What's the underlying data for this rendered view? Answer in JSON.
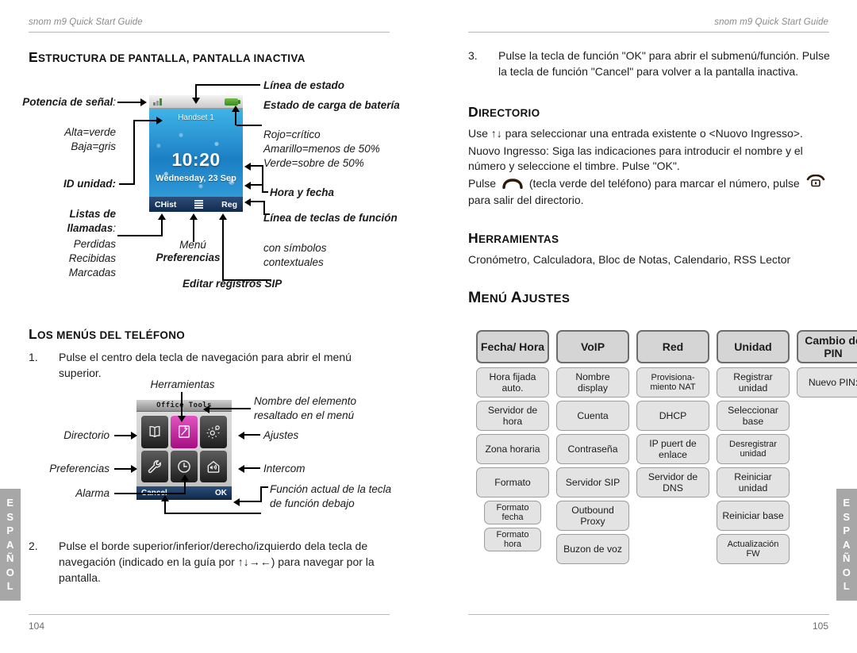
{
  "header": {
    "left_running_head": "snom m9 Quick Start Guide",
    "right_running_head": "snom m9 Quick Start Guide",
    "page_left": "104",
    "page_right": "105",
    "lang_tab": "ESPAÑOL"
  },
  "left_column": {
    "heading_screen_structure": {
      "cap": "E",
      "rest": "STRUCTURA DE PANTALLA, PANTALLA INACTIVA"
    },
    "heading_phone_menus": {
      "cap": "L",
      "rest": "OS MENÚS DEL TELÉFONO"
    },
    "callouts": {
      "signal_strength_title": "Potencia de señal",
      "signal_strength_colon": ":",
      "signal_line1": "Alta=verde",
      "signal_line2": "Baja=gris",
      "unit_id": "ID unidad:",
      "call_lists_title": "Listas de llamadas",
      "call_lists_colon": ":",
      "call_list_1": "Perdidas",
      "call_list_2": "Recibidas",
      "call_list_3": "Marcadas",
      "status_line": "Línea de estado",
      "battery_title": "Estado de carga de batería",
      "battery_line1": "Rojo=crítico",
      "battery_line2": "Amarillo=menos de 50%",
      "battery_line3": "Verde=sobre de 50%",
      "time_and_date": "Hora y fecha",
      "function_keys_title": "Línea de teclas de función",
      "function_keys_sub1": "con símbolos",
      "function_keys_sub2": "contextuales",
      "menu_word": "Menú",
      "preferences_word": "Preferencias",
      "edit_sip": "Editar registros SIP"
    },
    "step1": {
      "num": "1.",
      "text": "Pulse el centro dela tecla de navegación para abrir el menú superior."
    },
    "step2": {
      "num": "2.",
      "text": "Pulse el borde superior/inferior/derecho/izquierdo dela tecla de navegación (indicado en la guía por ↑↓→←) para navegar por la pantalla."
    },
    "menu_callouts": {
      "tools": "Herramientas",
      "highlighted_name": "Nombre del elemento resaltado en el menú",
      "directory": "Directorio",
      "settings": "Ajustes",
      "preferences": "Preferencias",
      "intercom": "Intercom",
      "alarm": "Alarma",
      "softkey_note": "Función actual de la tecla de función debajo"
    }
  },
  "phone_idle_screen": {
    "handset_label": "Handset 1",
    "time": "10:20",
    "date": "Wednesday, 23 Sep",
    "softkey_left": "CHist",
    "softkey_center_icon": "menu-lines-icon",
    "softkey_right": "Reg",
    "signal_icon": "signal-strength-icon",
    "battery_icon": "battery-icon"
  },
  "phone_menu_screen": {
    "title": "Office Tools",
    "tiles": [
      {
        "name": "directory-icon",
        "selected": false
      },
      {
        "name": "notes-edit-icon",
        "selected": true
      },
      {
        "name": "settings-gear-icon",
        "selected": false
      },
      {
        "name": "wrench-icon",
        "selected": false
      },
      {
        "name": "clock-icon",
        "selected": false
      },
      {
        "name": "intercom-home-icon",
        "selected": false
      }
    ],
    "softkey_left": "Cancel",
    "softkey_right": "OK"
  },
  "right_column": {
    "step3": {
      "num": "3.",
      "text": "Pulse la tecla de función \"OK\" para abrir el submenú/función. Pulse la tecla de función \"Cancel\" para volver a la pantalla inactiva."
    },
    "heading_directory": {
      "cap": "D",
      "rest": "IRECTORIO"
    },
    "directory_p1": "Use ↑↓ para seleccionar una entrada existente o <Nuovo Ingresso>.",
    "directory_p2": "Nuovo Ingresso:  Siga las indicaciones para introducir el nombre y el número y seleccione el timbre.  Pulse \"OK\".",
    "directory_p3_a": "Pulse",
    "directory_p3_b": "(tecla verde del teléfono) para marcar el número, pulse",
    "directory_p3_c": "para salir del directorio.",
    "heading_tools": {
      "cap": "H",
      "rest": "ERRAMIENTAS"
    },
    "tools_list": "Cronómetro, Calculadora, Bloc de Notas, Calendario, RSS Lector",
    "heading_settings_menu": {
      "cap1": "M",
      "rest1": "ENÚ ",
      "cap2": "A",
      "rest2": "JUSTES"
    }
  },
  "settings_map": {
    "columns": [
      {
        "head": "Fecha/ Hora",
        "items": [
          "Hora fijada auto.",
          "Servidor de hora",
          "Zona horaria",
          "Formato"
        ],
        "subitems": [
          "Formato fecha",
          "Formato hora"
        ]
      },
      {
        "head": "VoIP",
        "items": [
          "Nombre display",
          "Cuenta",
          "Contraseña",
          "Servidor SIP",
          "Outbound Proxy",
          "Buzon de voz"
        ],
        "subitems": []
      },
      {
        "head": "Red",
        "items": [
          "Provisiona- miento NAT",
          "DHCP",
          "IP puert de enlace",
          "Servidor de DNS"
        ],
        "subitems": []
      },
      {
        "head": "Unidad",
        "items": [
          "Registrar unidad",
          "Seleccionar base",
          "Desregistrar unidad",
          "Reiniciar unidad",
          "Reiniciar base",
          "Actualización FW"
        ],
        "subitems": []
      },
      {
        "head": "Cambio de PIN",
        "items": [
          "Nuevo PIN:"
        ],
        "subitems": []
      }
    ]
  }
}
